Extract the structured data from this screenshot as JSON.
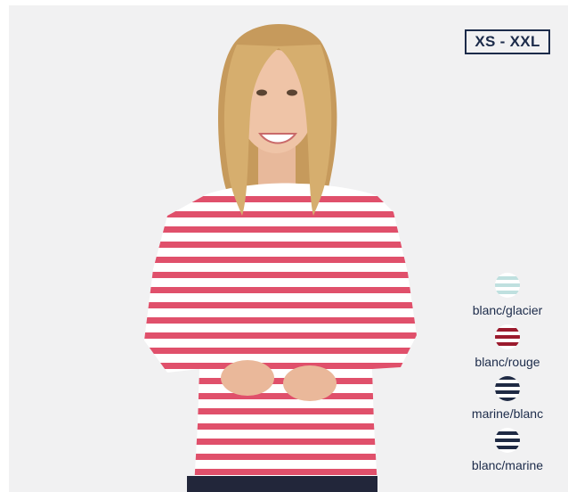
{
  "size_badge": "XS - XXL",
  "product_image": {
    "subject": "model-wearing-striped-long-sleeve-tee",
    "shirt_base": "#ffffff",
    "shirt_stripe": "#e0506b",
    "background": "#f1f1f2"
  },
  "colors": [
    {
      "label": "blanc/glacier",
      "stripe_a": "#ffffff",
      "stripe_b": "#bfe0df"
    },
    {
      "label": "blanc/rouge",
      "stripe_a": "#ffffff",
      "stripe_b": "#9b1b2e"
    },
    {
      "label": "marine/blanc",
      "stripe_a": "#1f2a44",
      "stripe_b": "#ffffff"
    },
    {
      "label": "blanc/marine",
      "stripe_a": "#ffffff",
      "stripe_b": "#1f2a44"
    }
  ]
}
